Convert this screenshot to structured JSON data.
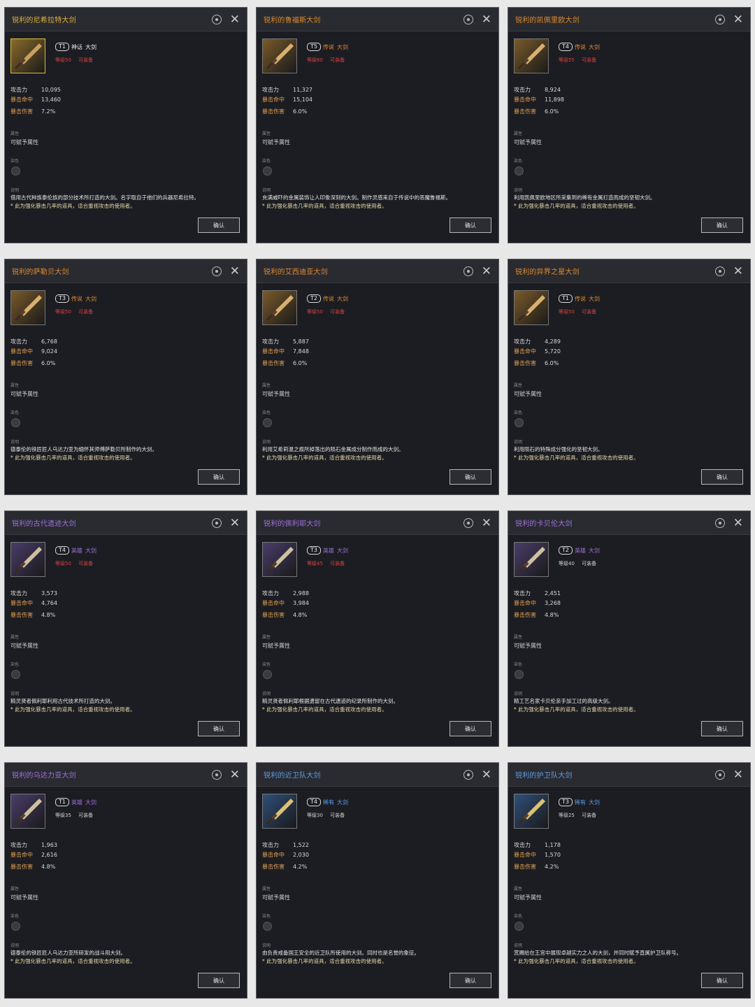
{
  "labels": {
    "attack": "攻击力",
    "crit_hit": "暴击命中",
    "crit_dmg": "暴击伤害",
    "attribute_section": "属性",
    "attribute_value": "可赋予属性",
    "dye_section": "染色",
    "desc_section": "说明",
    "confirm": "确认"
  },
  "colors": {
    "mythic": "#e0b040",
    "legendary": "#e08a2c",
    "heroic": "#a070e0",
    "rare": "#5a9fe8",
    "req_unmet": "#d94040",
    "req_met": "#d0d0d0",
    "stat_crit": "#e0a050"
  },
  "cards": [
    {
      "title": "锐利的尼希拉特大剑",
      "tier": "T1",
      "rarity": "神话",
      "rarity_key": "mythic",
      "type": "大剑",
      "level": "等级50",
      "equip": "可装备",
      "req_met": false,
      "attack": "10,095",
      "crit_hit": "13,460",
      "crit_dmg": "7.2%",
      "desc": "借用古代种族泰伦族的部分技术所打造的大剑。名字取自于他们的兵器尼希拉特。",
      "note": "* 此为强化暴击几率的道具，适合重视攻击的使用者。",
      "icon": "greatsword-icon"
    },
    {
      "title": "锐利的鲁福斯大剑",
      "tier": "T5",
      "rarity": "传说",
      "rarity_key": "legendary",
      "type": "大剑",
      "level": "等级60",
      "equip": "可装备",
      "req_met": false,
      "attack": "11,327",
      "crit_hit": "15,104",
      "crit_dmg": "6.0%",
      "desc": "充满威吓的金属装饰让人印象深刻的大剑。制作灵感来自于传说中的恶魔鲁福斯。",
      "note": "* 此为强化暴击几率的道具，适合重视攻击的使用者。",
      "icon": "greatsword-icon"
    },
    {
      "title": "锐利的凯佩里欧大剑",
      "tier": "T4",
      "rarity": "传说",
      "rarity_key": "legendary",
      "type": "大剑",
      "level": "等级55",
      "equip": "可装备",
      "req_met": false,
      "attack": "8,924",
      "crit_hit": "11,898",
      "crit_dmg": "6.0%",
      "desc": "利用凯佩里欧地区所采集到的稀有金属打造而成的坚韧大剑。",
      "note": "* 此为强化暴击几率的道具，适合重视攻击的使用者。",
      "icon": "greatsword-icon"
    },
    {
      "title": "锐利的萨勒贝大剑",
      "tier": "T3",
      "rarity": "传说",
      "rarity_key": "legendary",
      "type": "大剑",
      "level": "等级50",
      "equip": "可装备",
      "req_met": false,
      "attack": "6,768",
      "crit_hit": "9,024",
      "crit_dmg": "6.0%",
      "desc": "德泰伦的铁匠匠人乌达力亚为缅怀其师傅萨勒贝所制作的大剑。",
      "note": "* 此为强化暴击几率的道具，适合重视攻击的使用者。",
      "icon": "greatsword-icon"
    },
    {
      "title": "锐利的艾西迪亚大剑",
      "tier": "T2",
      "rarity": "传说",
      "rarity_key": "legendary",
      "type": "大剑",
      "level": "等级50",
      "equip": "可装备",
      "req_met": false,
      "attack": "5,887",
      "crit_hit": "7,848",
      "crit_dmg": "6.0%",
      "desc": "利用艾希莉温之痕所掉落出的陨石金属成分制作而成的大剑。",
      "note": "* 此为强化暴击几率的道具，适合重视攻击的使用者。",
      "icon": "greatsword-icon"
    },
    {
      "title": "锐利的异界之星大剑",
      "tier": "T1",
      "rarity": "传说",
      "rarity_key": "legendary",
      "type": "大剑",
      "level": "等级50",
      "equip": "可装备",
      "req_met": false,
      "attack": "4,289",
      "crit_hit": "5,720",
      "crit_dmg": "6.0%",
      "desc": "利用陨石的特殊成分强化的坚韧大剑。",
      "note": "* 此为强化暴击几率的道具，适合重视攻击的使用者。",
      "icon": "greatsword-icon"
    },
    {
      "title": "锐利的古代遗迹大剑",
      "tier": "T4",
      "rarity": "英雄",
      "rarity_key": "heroic",
      "type": "大剑",
      "level": "等级50",
      "equip": "可装备",
      "req_met": false,
      "attack": "3,573",
      "crit_hit": "4,764",
      "crit_dmg": "4.8%",
      "desc": "精灵贤者佩利耶利用古代技术所打造的大剑。",
      "note": "* 此为强化暴击几率的道具，适合重视攻击的使用者。",
      "icon": "greatsword-icon"
    },
    {
      "title": "锐利的佩利耶大剑",
      "tier": "T3",
      "rarity": "英雄",
      "rarity_key": "heroic",
      "type": "大剑",
      "level": "等级45",
      "equip": "可装备",
      "req_met": false,
      "attack": "2,988",
      "crit_hit": "3,984",
      "crit_dmg": "4.8%",
      "desc": "精灵贤者佩利耶根据遗留在古代遗迹的纪录所制作的大剑。",
      "note": "* 此为强化暴击几率的道具，适合重视攻击的使用者。",
      "icon": "greatsword-icon"
    },
    {
      "title": "锐利的卡贝伦大剑",
      "tier": "T2",
      "rarity": "英雄",
      "rarity_key": "heroic",
      "type": "大剑",
      "level": "等级40",
      "equip": "可装备",
      "req_met": true,
      "attack": "2,451",
      "crit_hit": "3,268",
      "crit_dmg": "4.8%",
      "desc": "精工艺名家卡贝伦亲手加工过的高级大剑。",
      "note": "* 此为强化暴击几率的道具，适合重视攻击的使用者。",
      "icon": "greatsword-icon"
    },
    {
      "title": "锐利的乌达力亚大剑",
      "tier": "T1",
      "rarity": "英雄",
      "rarity_key": "heroic",
      "type": "大剑",
      "level": "等级35",
      "equip": "可装备",
      "req_met": true,
      "attack": "1,963",
      "crit_hit": "2,616",
      "crit_dmg": "4.8%",
      "desc": "德泰伦的铁匠匠人乌达力亚所研发的战斗用大剑。",
      "note": "* 此为强化暴击几率的道具，适合重视攻击的使用者。",
      "icon": "greatsword-icon"
    },
    {
      "title": "锐利的近卫队大剑",
      "tier": "T4",
      "rarity": "稀有",
      "rarity_key": "rare",
      "type": "大剑",
      "level": "等级30",
      "equip": "可装备",
      "req_met": true,
      "attack": "1,522",
      "crit_hit": "2,030",
      "crit_dmg": "4.2%",
      "desc": "由负责戒备国王安全的近卫队所使用的大剑。同时也是名誉的象征。",
      "note": "* 此为强化暴击几率的道具，适合重视攻击的使用者。",
      "icon": "greatsword-icon"
    },
    {
      "title": "锐利的护卫队大剑",
      "tier": "T3",
      "rarity": "稀有",
      "rarity_key": "rare",
      "type": "大剑",
      "level": "等级25",
      "equip": "可装备",
      "req_met": true,
      "attack": "1,178",
      "crit_hit": "1,570",
      "crit_dmg": "4.2%",
      "desc": "赏赐给在王宫中展现卓越实力之人的大剑，并同时赋予直属护卫队称号。",
      "note": "* 此为强化暴击几率的道具，适合重视攻击的使用者。",
      "icon": "greatsword-icon"
    }
  ]
}
